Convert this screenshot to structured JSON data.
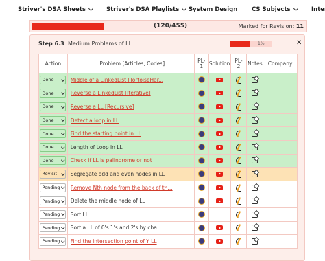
{
  "nav": {
    "items": [
      {
        "label": "Striver's DSA Sheets",
        "has_chevron": true
      },
      {
        "label": "Striver's DSA Playlists",
        "has_chevron": true
      },
      {
        "label": "System Design",
        "has_chevron": false
      },
      {
        "label": "CS Subjects",
        "has_chevron": true
      },
      {
        "label": "Intern",
        "has_chevron": false
      }
    ]
  },
  "progress": {
    "count": "(120/455)",
    "fraction": 0.264,
    "marked_label": "Marked for Revision:",
    "marked_count": "11"
  },
  "step": {
    "code": "Step 6.3",
    "title": ": Medium Problems of LL",
    "pct": "1%",
    "fraction": 0.49
  },
  "columns": {
    "action": "Action",
    "problem": "Problem [Articles, Codes]",
    "pl1": "PL-\n1",
    "solution": "Solution",
    "pl2": "PL-\n2",
    "notes": "Notes",
    "company": "Company"
  },
  "rows": [
    {
      "status": "Done",
      "problem": "Middle of a LinkedList [TortoiseHar...",
      "link": true,
      "youtube": true
    },
    {
      "status": "Done",
      "problem": "Reverse a LinkedList [Iterative]",
      "link": true,
      "youtube": true
    },
    {
      "status": "Done",
      "problem": "Reverse a LL [Recursive]",
      "link": true,
      "youtube": true
    },
    {
      "status": "Done",
      "problem": "Detect a loop in LL",
      "link": true,
      "youtube": true
    },
    {
      "status": "Done",
      "problem": "Find the starting point in LL",
      "link": true,
      "youtube": true
    },
    {
      "status": "Done",
      "problem": "Length of Loop in LL",
      "link": false,
      "youtube": true
    },
    {
      "status": "Done",
      "problem": "Check if LL is palindrome or not",
      "link": true,
      "youtube": true
    },
    {
      "status": "Revisit",
      "problem": "Segregate odd and even nodes in LL",
      "link": false,
      "youtube": true
    },
    {
      "status": "Pending",
      "problem": "Remove Nth node from the back of th...",
      "link": true,
      "youtube": true
    },
    {
      "status": "Pending",
      "problem": "Delete the middle node of LL",
      "link": false,
      "youtube": true
    },
    {
      "status": "Pending",
      "problem": "Sort LL",
      "link": false,
      "youtube": false
    },
    {
      "status": "Pending",
      "problem": "Sort a LL of 0's 1's and 2's by cha...",
      "link": false,
      "youtube": true
    },
    {
      "status": "Pending",
      "problem": "Find the intersection point of Y LL",
      "link": true,
      "youtube": true
    }
  ]
}
